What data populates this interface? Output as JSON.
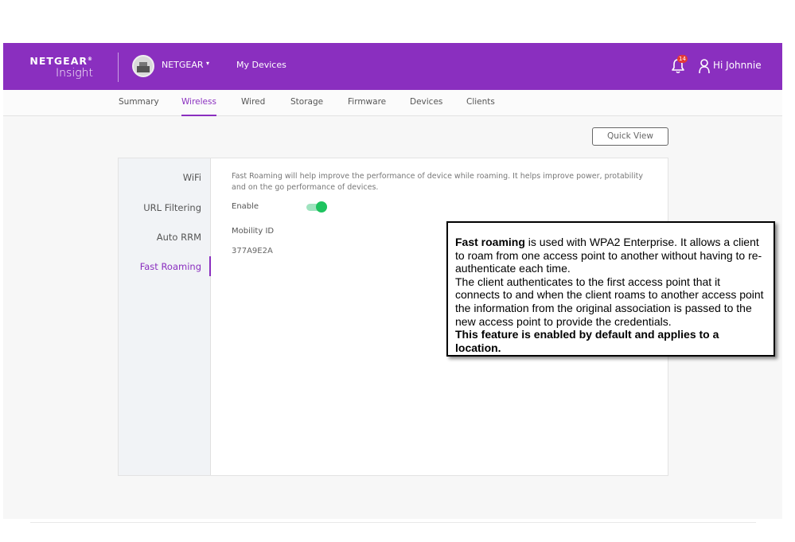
{
  "brand": {
    "logo_main": "NETGEAR",
    "logo_mark": "®",
    "logo_sub": "Insight",
    "accent_color": "#8a2fbf"
  },
  "header": {
    "org_name": "NETGEAR",
    "org_caret": "▾",
    "my_devices": "My Devices",
    "notification_count": "14",
    "user_greeting": "Hi Johnnie"
  },
  "tabs": [
    {
      "label": "Summary"
    },
    {
      "label": "Wireless",
      "active": true
    },
    {
      "label": "Wired"
    },
    {
      "label": "Storage"
    },
    {
      "label": "Firmware"
    },
    {
      "label": "Devices"
    },
    {
      "label": "Clients"
    }
  ],
  "quick_view_label": "Quick View",
  "sidebar": {
    "items": [
      {
        "label": "WiFi"
      },
      {
        "label": "URL Filtering"
      },
      {
        "label": "Auto RRM"
      },
      {
        "label": "Fast Roaming",
        "active": true
      }
    ]
  },
  "content": {
    "description": "Fast Roaming will help improve the performance of device while roaming. It helps improve power, protability and on the go performance of devices.",
    "enable_label": "Enable",
    "enable_state": true,
    "mobility_id_label": "Mobility ID",
    "mobility_id_value": "377A9E2A"
  },
  "callout": {
    "term": "Fast roaming",
    "line1_rest": " is used with WPA2 Enterprise. It allows a client to roam from one access point to another without having to re-authenticate each time.",
    "line2": "The client authenticates to the first access point that it connects to and when the client roams to another access point the information from the original association is passed to the new access point to provide the credentials.",
    "line3": "This feature is enabled by default and applies to a location."
  },
  "icons": {
    "bell": "bell-icon",
    "user": "user-icon",
    "org": "org-avatar",
    "toggle_on_color": "#1ec35f"
  }
}
